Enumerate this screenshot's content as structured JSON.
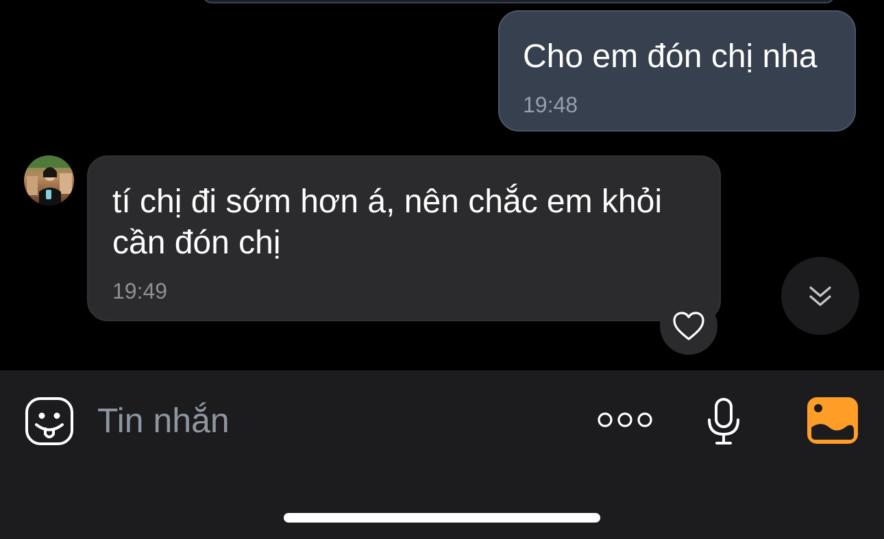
{
  "messages": [
    {
      "direction": "outgoing",
      "text": "Cho em đón chị nha",
      "time": "19:48"
    },
    {
      "direction": "incoming",
      "text": "tí chị đi sớm hơn á, nên chắc em khỏi cần đón chị",
      "time": "19:49"
    }
  ],
  "composer": {
    "placeholder": "Tin nhắn"
  },
  "icons": {
    "sticker": "sticker-face-icon",
    "more": "more-options-icon",
    "mic": "microphone-icon",
    "gallery": "image-gallery-icon",
    "react": "heart-icon",
    "scroll_down": "double-chevron-down-icon"
  },
  "colors": {
    "outgoing_bubble": "#37404f",
    "incoming_bubble": "#2b2b2d",
    "gallery_accent": "#ff9d26"
  }
}
